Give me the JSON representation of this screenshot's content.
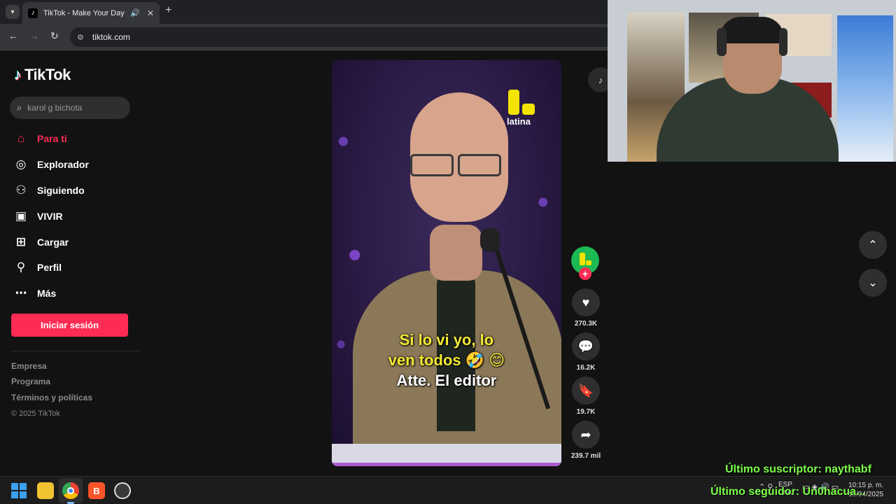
{
  "browser": {
    "tab_title": "TikTok - Make Your Day",
    "url": "tiktok.com"
  },
  "tiktok": {
    "logo_text": "TikTok",
    "search_placeholder": "karol g bichota",
    "nav": [
      {
        "label": "Para ti",
        "icon": "home-icon",
        "active": true
      },
      {
        "label": "Explorador",
        "icon": "compass-icon"
      },
      {
        "label": "Siguiendo",
        "icon": "following-icon"
      },
      {
        "label": "VIVIR",
        "icon": "live-tv-icon"
      },
      {
        "label": "Cargar",
        "icon": "upload-plus-icon"
      },
      {
        "label": "Perfil",
        "icon": "profile-icon"
      },
      {
        "label": "Más",
        "icon": "more-dots-icon"
      }
    ],
    "login_label": "Iniciar sesión",
    "footer_links": [
      "Empresa",
      "Programa",
      "Términos y políticas"
    ],
    "copyright": "© 2025 TikTok",
    "accent_color": "#fe2c55"
  },
  "video": {
    "channel_logo_text": "latina",
    "caption_line1": "Si lo vi yo, lo",
    "caption_line2": "ven todos 🤣 😊",
    "caption_line3": "Atte. El editor",
    "likes": "270.3K",
    "comments": "16.2K",
    "saves": "19.7K",
    "shares": "239.7 mil"
  },
  "stream_overlay": {
    "last_subscriber": "Último suscriptor: naythabf",
    "last_follower": "Último seguidor: Un0hacua..."
  },
  "taskbar": {
    "lang_line1": "ESP",
    "lang_line2": "LAA",
    "time": "10:15 p. m.",
    "date": "10/04/2025"
  }
}
